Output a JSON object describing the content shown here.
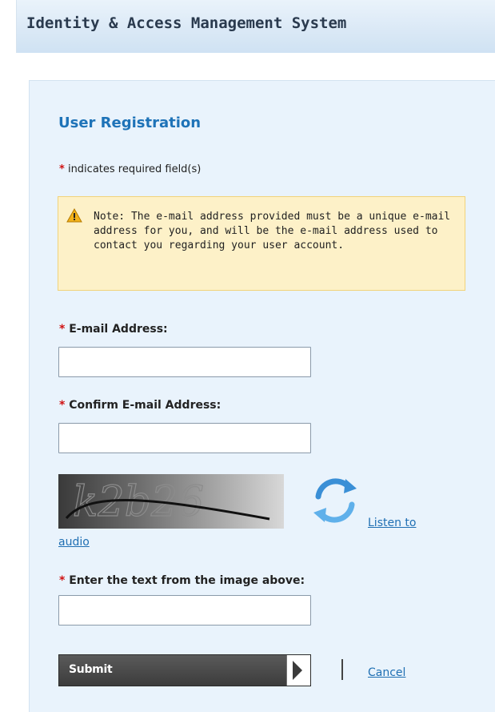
{
  "header": {
    "title": "Identity & Access Management System"
  },
  "form": {
    "title": "User Registration",
    "required_note": "indicates required field(s)",
    "required_marker": "*",
    "note": "Note: The e-mail address provided must be a unique e-mail address for you, and will be the e-mail address used to contact you regarding your user account.",
    "email_label": "E-mail Address:",
    "email_value": "",
    "confirm_label": "Confirm E-mail Address:",
    "confirm_value": "",
    "captcha_text": "k2b26",
    "listen_link_line1": "Listen to",
    "listen_link_line2": "audio",
    "captcha_label": "Enter the text from the image above:",
    "captcha_value": "",
    "submit_label": "Submit",
    "cancel_label": "Cancel"
  },
  "colors": {
    "title": "#1e73b8",
    "required": "#d01111",
    "link": "#1f6fb3",
    "note_bg": "#fdf1c8"
  }
}
